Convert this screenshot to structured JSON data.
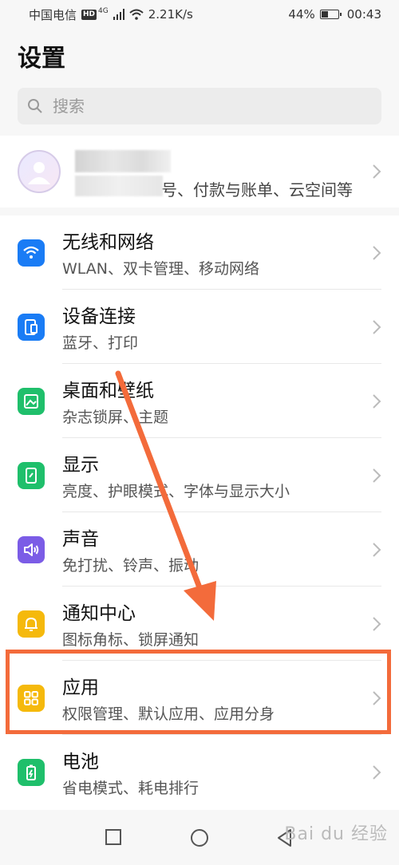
{
  "status_bar": {
    "carrier": "中国电信",
    "hd": "HD",
    "network": "4G",
    "speed": "2.21K/s",
    "battery": "44%",
    "battery_level": 0.44,
    "time": "00:43"
  },
  "header": {
    "title": "设置"
  },
  "search": {
    "placeholder": "搜索"
  },
  "account": {
    "subtitle": "号、付款与账单、云空间等"
  },
  "settings": [
    {
      "title": "无线和网络",
      "subtitle": "WLAN、双卡管理、移动网络",
      "icon": "wifi-icon",
      "color": "#1a7cf5"
    },
    {
      "title": "设备连接",
      "subtitle": "蓝牙、打印",
      "icon": "device-connect-icon",
      "color": "#1a7cf5"
    },
    {
      "title": "桌面和壁纸",
      "subtitle": "杂志锁屏、主题",
      "icon": "wallpaper-icon",
      "color": "#1fbf6b"
    },
    {
      "title": "显示",
      "subtitle": "亮度、护眼模式、字体与显示大小",
      "icon": "display-icon",
      "color": "#1fbf6b"
    },
    {
      "title": "声音",
      "subtitle": "免打扰、铃声、振动",
      "icon": "sound-icon",
      "color": "#7b5ce6"
    },
    {
      "title": "通知中心",
      "subtitle": "图标角标、锁屏通知",
      "icon": "bell-icon",
      "color": "#f5b90c"
    },
    {
      "title": "应用",
      "subtitle": "权限管理、默认应用、应用分身",
      "icon": "apps-grid-icon",
      "color": "#f5b90c"
    },
    {
      "title": "电池",
      "subtitle": "省电模式、耗电排行",
      "icon": "battery-icon",
      "color": "#1fbf6b"
    }
  ],
  "annotation": {
    "highlight_color": "#f36b3b"
  },
  "nav": {
    "recent": "square-icon",
    "home": "circle-icon",
    "back": "triangle-icon"
  },
  "watermark": "Bai du 经验"
}
